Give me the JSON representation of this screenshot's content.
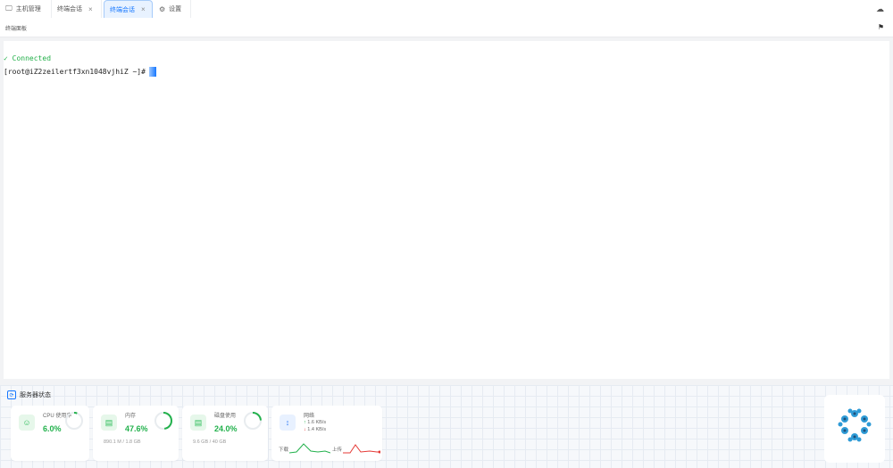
{
  "tabs": [
    {
      "label": "主机管理",
      "icon": "monitor-icon",
      "closable": false,
      "active": false
    },
    {
      "label": "终端会话",
      "icon": "",
      "closable": true,
      "active": false
    },
    {
      "label": "终端会话",
      "icon": "",
      "closable": true,
      "active": true
    },
    {
      "label": "设置",
      "icon": "gear-icon",
      "closable": false,
      "active": false
    }
  ],
  "toolbar": {
    "title": "终端面板"
  },
  "terminal": {
    "connected_mark": "✓",
    "connected_text": "Connected",
    "prompt": "[root@iZ2zeilertf3xn1048vjhiZ ~]#"
  },
  "status": {
    "title": "服务器状态",
    "cpu": {
      "label": "CPU 使用率",
      "value": "6.0%",
      "fraction": 0.06
    },
    "memory": {
      "label": "内存",
      "value": "47.6%",
      "detail": "890.1 M / 1.8 GB",
      "fraction": 0.476
    },
    "disk": {
      "label": "磁盘使用",
      "value": "24.0%",
      "detail": "9.6 GB / 40 GB",
      "fraction": 0.24
    },
    "network": {
      "label": "网络",
      "up": "1.6 KB/s",
      "down": "1.4 KB/s",
      "down_label": "下载",
      "up_label": "上传"
    }
  },
  "colors": {
    "accent": "#1677ff",
    "green": "#22b14c",
    "red": "#e53935"
  }
}
